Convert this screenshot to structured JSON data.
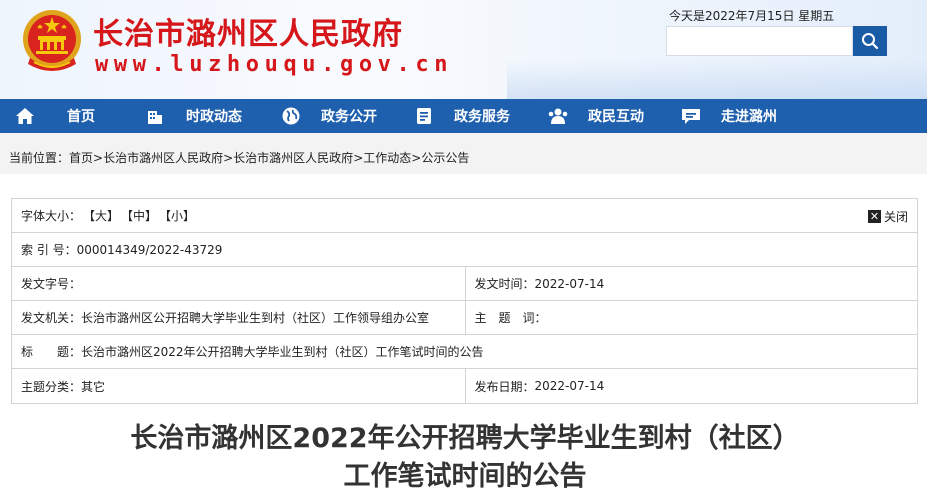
{
  "header": {
    "site_title": "长治市潞州区人民政府",
    "site_url": "www.luzhouqu.gov.cn",
    "date": "今天是2022年7月15日 星期五",
    "search_placeholder": "",
    "search_icon": "search-icon"
  },
  "nav": {
    "items": [
      {
        "label": "首页",
        "icon": "home-icon"
      },
      {
        "label": "时政动态",
        "icon": "building-icon"
      },
      {
        "label": "政务公开",
        "icon": "globe-icon"
      },
      {
        "label": "政务服务",
        "icon": "document-icon"
      },
      {
        "label": "政民互动",
        "icon": "people-icon"
      },
      {
        "label": "走进潞州",
        "icon": "chat-icon"
      }
    ],
    "color": "#1e5fae"
  },
  "breadcrumb": {
    "prefix": "当前位置：",
    "items": [
      "首页",
      "长治市潞州区人民政府",
      "长治市潞州区人民政府",
      "工作动态",
      "公示公告"
    ],
    "sep": ">"
  },
  "info": {
    "font_label": "字体大小：",
    "size_large": "【大】",
    "size_medium": "【中】",
    "size_small": "【小】",
    "close_label": "关闭",
    "index_label": "索 引 号：",
    "index_value": "000014349/2022-43729",
    "doc_no_label": "发文字号：",
    "doc_no_value": "",
    "issue_time_label": "发文时间：",
    "issue_time_value": "2022-07-14",
    "issuer_label": "发文机关：",
    "issuer_value": "长治市潞州区公开招聘大学毕业生到村（社区）工作领导组办公室",
    "subject_label": "主　题　词：",
    "subject_value": "",
    "title_label": "标　　题：",
    "title_value": "长治市潞州区2022年公开招聘大学毕业生到村（社区）工作笔试时间的公告",
    "category_label": "主题分类：",
    "category_value": "其它",
    "publish_label": "发布日期：",
    "publish_value": "2022-07-14"
  },
  "article": {
    "title": "长治市潞州区2022年公开招聘大学毕业生到村（社区）工作笔试时间的公告"
  },
  "colors": {
    "brand_red": "#d5171b",
    "nav_blue": "#1e5fae"
  }
}
